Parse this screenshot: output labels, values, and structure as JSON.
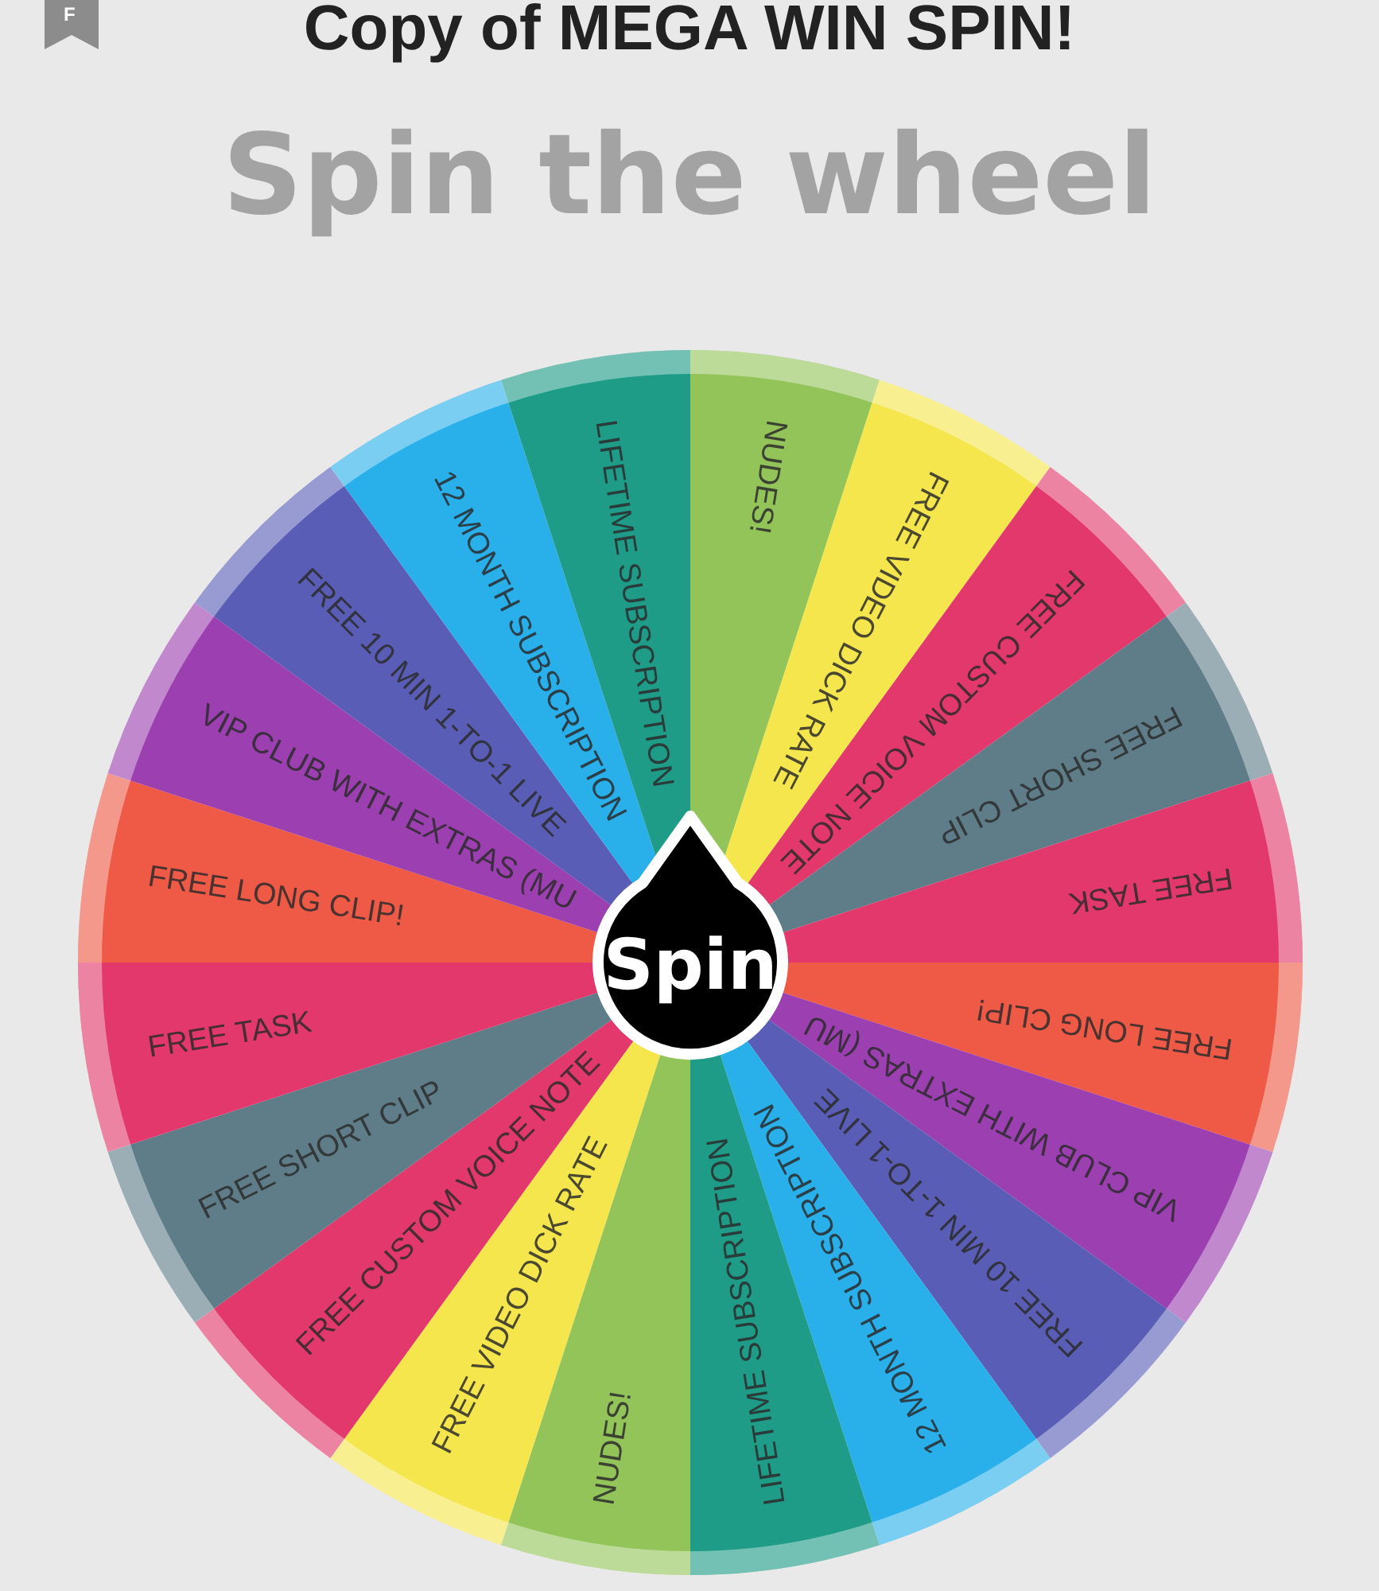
{
  "header": {
    "badge_letter": "F",
    "title": "Copy of MEGA WIN SPIN!"
  },
  "heading": "Spin the wheel",
  "wheel": {
    "segments": [
      {
        "label": "NUDES!",
        "color": "#93c45a"
      },
      {
        "label": "FREE VIDEO DICK RATE",
        "color": "#f4e64c"
      },
      {
        "label": "FREE CUSTOM VOICE NOTE",
        "color": "#e2386b"
      },
      {
        "label": "FREE SHORT CLIP",
        "color": "#5e7d89"
      },
      {
        "label": "FREE TASK",
        "color": "#e2386b"
      },
      {
        "label": "FREE LONG CLIP!",
        "color": "#ee5a46"
      },
      {
        "label": "VIP CLUB WITH EXTRAS (MU",
        "color": "#9b3fb1"
      },
      {
        "label": "FREE 10 MIN 1-TO-1 LIVE",
        "color": "#5a5db6"
      },
      {
        "label": "12 MONTH SUBSCRIPTION",
        "color": "#29b0ea"
      },
      {
        "label": "LIFETIME SUBSCRIPTION",
        "color": "#1e9c88"
      },
      {
        "label": "NUDES!",
        "color": "#93c45a"
      },
      {
        "label": "FREE VIDEO DICK RATE",
        "color": "#f4e64c"
      },
      {
        "label": "FREE CUSTOM VOICE NOTE",
        "color": "#e2386b"
      },
      {
        "label": "FREE SHORT CLIP",
        "color": "#5e7d89"
      },
      {
        "label": "FREE TASK",
        "color": "#e2386b"
      },
      {
        "label": "FREE LONG CLIP!",
        "color": "#ee5a46"
      },
      {
        "label": "VIP CLUB WITH EXTRAS (MU",
        "color": "#9b3fb1"
      },
      {
        "label": "FREE 10 MIN 1-TO-1 LIVE",
        "color": "#5a5db6"
      },
      {
        "label": "12 MONTH SUBSCRIPTION",
        "color": "#29b0ea"
      },
      {
        "label": "LIFETIME SUBSCRIPTION",
        "color": "#1e9c88"
      }
    ],
    "spin_button": "Spin"
  }
}
